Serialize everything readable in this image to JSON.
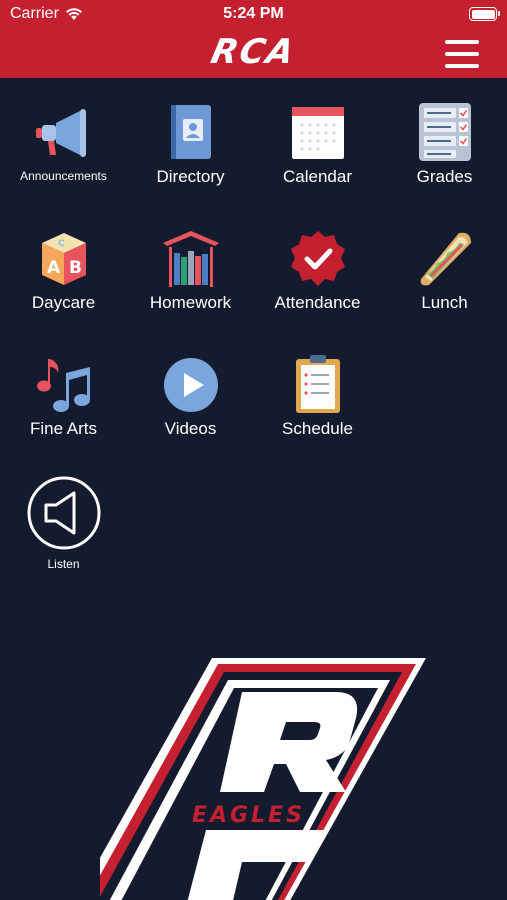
{
  "status_bar": {
    "carrier": "Carrier",
    "time": "5:24 PM"
  },
  "header": {
    "logo_text": "RCA",
    "menu_icon": "hamburger-menu-icon"
  },
  "tiles": [
    {
      "label": "Announcements",
      "icon": "megaphone-icon"
    },
    {
      "label": "Directory",
      "icon": "address-book-icon"
    },
    {
      "label": "Calendar",
      "icon": "calendar-icon"
    },
    {
      "label": "Grades",
      "icon": "grades-checklist-icon"
    },
    {
      "label": "Daycare",
      "icon": "abc-blocks-icon"
    },
    {
      "label": "Homework",
      "icon": "bookshelf-icon"
    },
    {
      "label": "Attendance",
      "icon": "check-badge-icon"
    },
    {
      "label": "Lunch",
      "icon": "sandwich-icon"
    },
    {
      "label": "Fine Arts",
      "icon": "music-notes-icon"
    },
    {
      "label": "Videos",
      "icon": "play-button-icon"
    },
    {
      "label": "Schedule",
      "icon": "clipboard-icon"
    },
    {
      "label": "Listen",
      "icon": "speaker-icon"
    }
  ],
  "emblem": {
    "letters": "RC",
    "text": "EAGLES"
  },
  "colors": {
    "brand_red": "#c4202f",
    "background": "#151b2e",
    "text": "#ffffff"
  }
}
